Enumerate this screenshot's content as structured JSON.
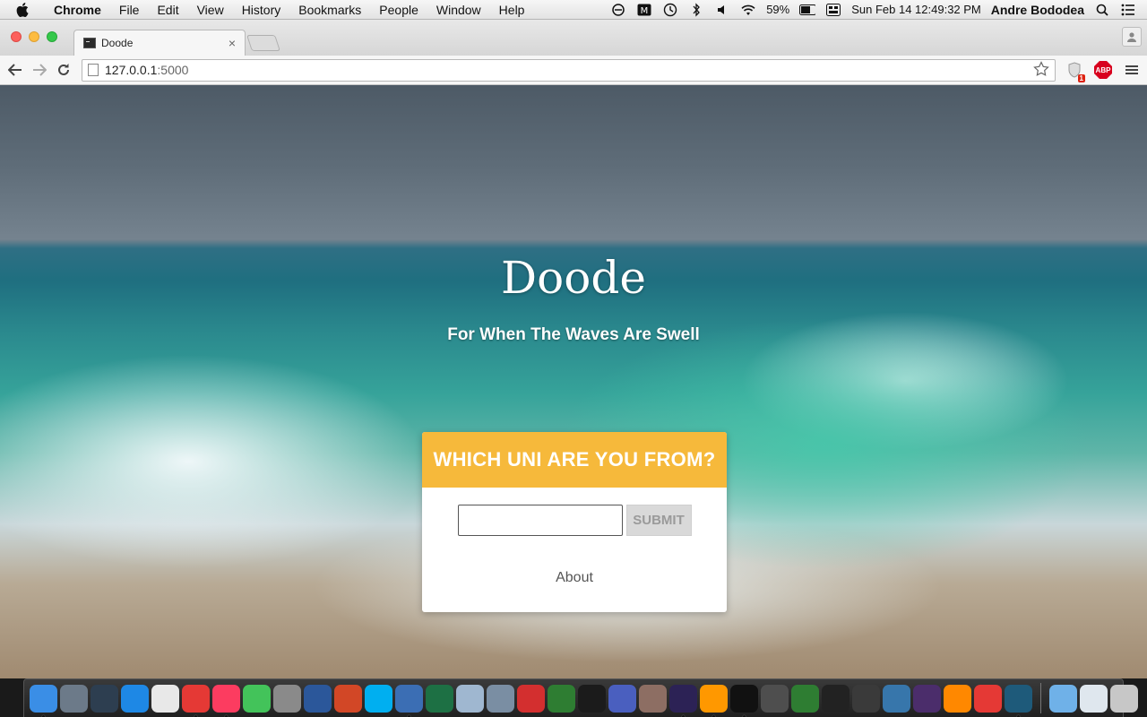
{
  "menubar": {
    "app_name": "Chrome",
    "menus": [
      "File",
      "Edit",
      "View",
      "History",
      "Bookmarks",
      "People",
      "Window",
      "Help"
    ],
    "battery": "59%",
    "datetime": "Sun Feb 14  12:49:32 PM",
    "user": "Andre Bododea"
  },
  "browser": {
    "tab_title": "Doode",
    "tab_close": "×",
    "url_host": "127.0.0.1",
    "url_port": ":5000",
    "ext_badge": "1",
    "abp_label": "ABP"
  },
  "page": {
    "title": "Doode",
    "tagline": "For When The Waves Are Swell",
    "card_heading": "WHICH UNI ARE YOU FROM?",
    "input_value": "",
    "submit_label": "SUBMIT",
    "about_link": "About"
  },
  "dock": {
    "icons": [
      {
        "name": "finder",
        "color": "#3a8ee6",
        "running": true
      },
      {
        "name": "launchpad",
        "color": "#6c7a89",
        "running": false
      },
      {
        "name": "mission-control",
        "color": "#2d3e50",
        "running": false
      },
      {
        "name": "safari",
        "color": "#1e88e5",
        "running": false
      },
      {
        "name": "textedit",
        "color": "#e8e8e8",
        "running": false
      },
      {
        "name": "chrome",
        "color": "#e53935",
        "running": true
      },
      {
        "name": "itunes",
        "color": "#fc3c60",
        "running": true
      },
      {
        "name": "facetime",
        "color": "#43c35a",
        "running": false
      },
      {
        "name": "system-preferences",
        "color": "#8a8a8a",
        "running": false
      },
      {
        "name": "word",
        "color": "#2b579a",
        "running": false
      },
      {
        "name": "powerpoint",
        "color": "#d24726",
        "running": false
      },
      {
        "name": "skype",
        "color": "#00aff0",
        "running": false
      },
      {
        "name": "thunderbird",
        "color": "#3b6eb4",
        "running": true
      },
      {
        "name": "excel",
        "color": "#1d7044",
        "running": false
      },
      {
        "name": "preview",
        "color": "#9fb7d0",
        "running": false
      },
      {
        "name": "image-capture",
        "color": "#7a8ea3",
        "running": false
      },
      {
        "name": "crossover",
        "color": "#d32f2f",
        "running": false
      },
      {
        "name": "sourcetree",
        "color": "#2e7d32",
        "running": false
      },
      {
        "name": "activity-monitor",
        "color": "#1b1b1b",
        "running": false
      },
      {
        "name": "xcode",
        "color": "#4a5fbf",
        "running": false
      },
      {
        "name": "gimp",
        "color": "#8d6e63",
        "running": false
      },
      {
        "name": "eclipse",
        "color": "#2c2255",
        "running": true
      },
      {
        "name": "sublime-text",
        "color": "#ff9800",
        "running": true
      },
      {
        "name": "terminal",
        "color": "#111111",
        "running": true
      },
      {
        "name": "calculator",
        "color": "#4e4e4e",
        "running": false
      },
      {
        "name": "ios-simulator",
        "color": "#2e7d32",
        "running": false
      },
      {
        "name": "logitech-live",
        "color": "#222222",
        "running": false
      },
      {
        "name": "fb-app",
        "color": "#3a3a3a",
        "running": false
      },
      {
        "name": "python-launcher",
        "color": "#3776ab",
        "running": false
      },
      {
        "name": "texshop",
        "color": "#4b2d6b",
        "running": false
      },
      {
        "name": "vlc",
        "color": "#ff8800",
        "running": false
      },
      {
        "name": "istat-menus",
        "color": "#e53935",
        "running": false
      },
      {
        "name": "network-radar",
        "color": "#1e5a7a",
        "running": true
      },
      {
        "name": "applications-folder",
        "color": "#6fb1e8",
        "running": false
      },
      {
        "name": "documents-folder",
        "color": "#dfe7ee",
        "running": false
      },
      {
        "name": "trash",
        "color": "#c7c7c7",
        "running": false
      }
    ]
  }
}
